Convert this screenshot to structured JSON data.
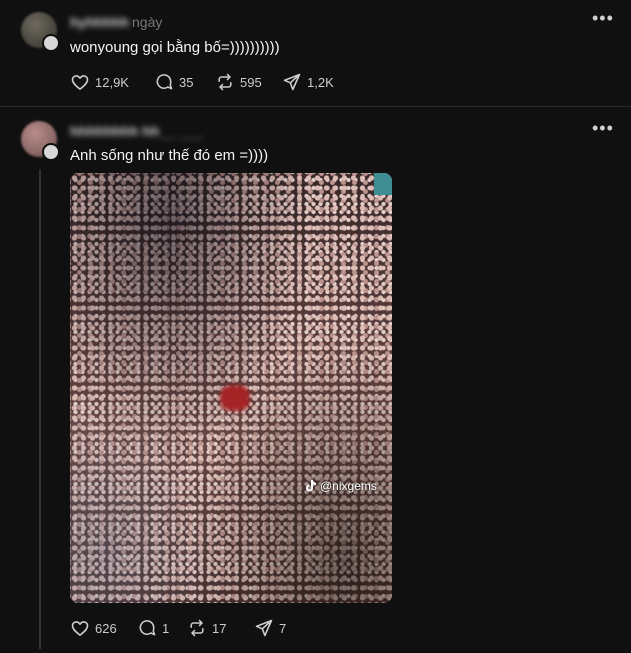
{
  "posts": [
    {
      "time": "ngày",
      "content": "wonyoung gọi bằng bố=))))))))))",
      "likes": "12,9K",
      "replies": "35",
      "reposts": "595",
      "shares": "1,2K"
    },
    {
      "content": "Anh sống như thế đó em =))))",
      "media_watermark": "@nixgems",
      "likes": "626",
      "replies": "1",
      "reposts": "17",
      "shares": "7"
    }
  ],
  "icons": {
    "more": "more-horizontal-icon",
    "like": "heart-icon",
    "reply": "comment-icon",
    "repost": "repost-icon",
    "share": "send-icon",
    "watermark": "tiktok-icon"
  }
}
